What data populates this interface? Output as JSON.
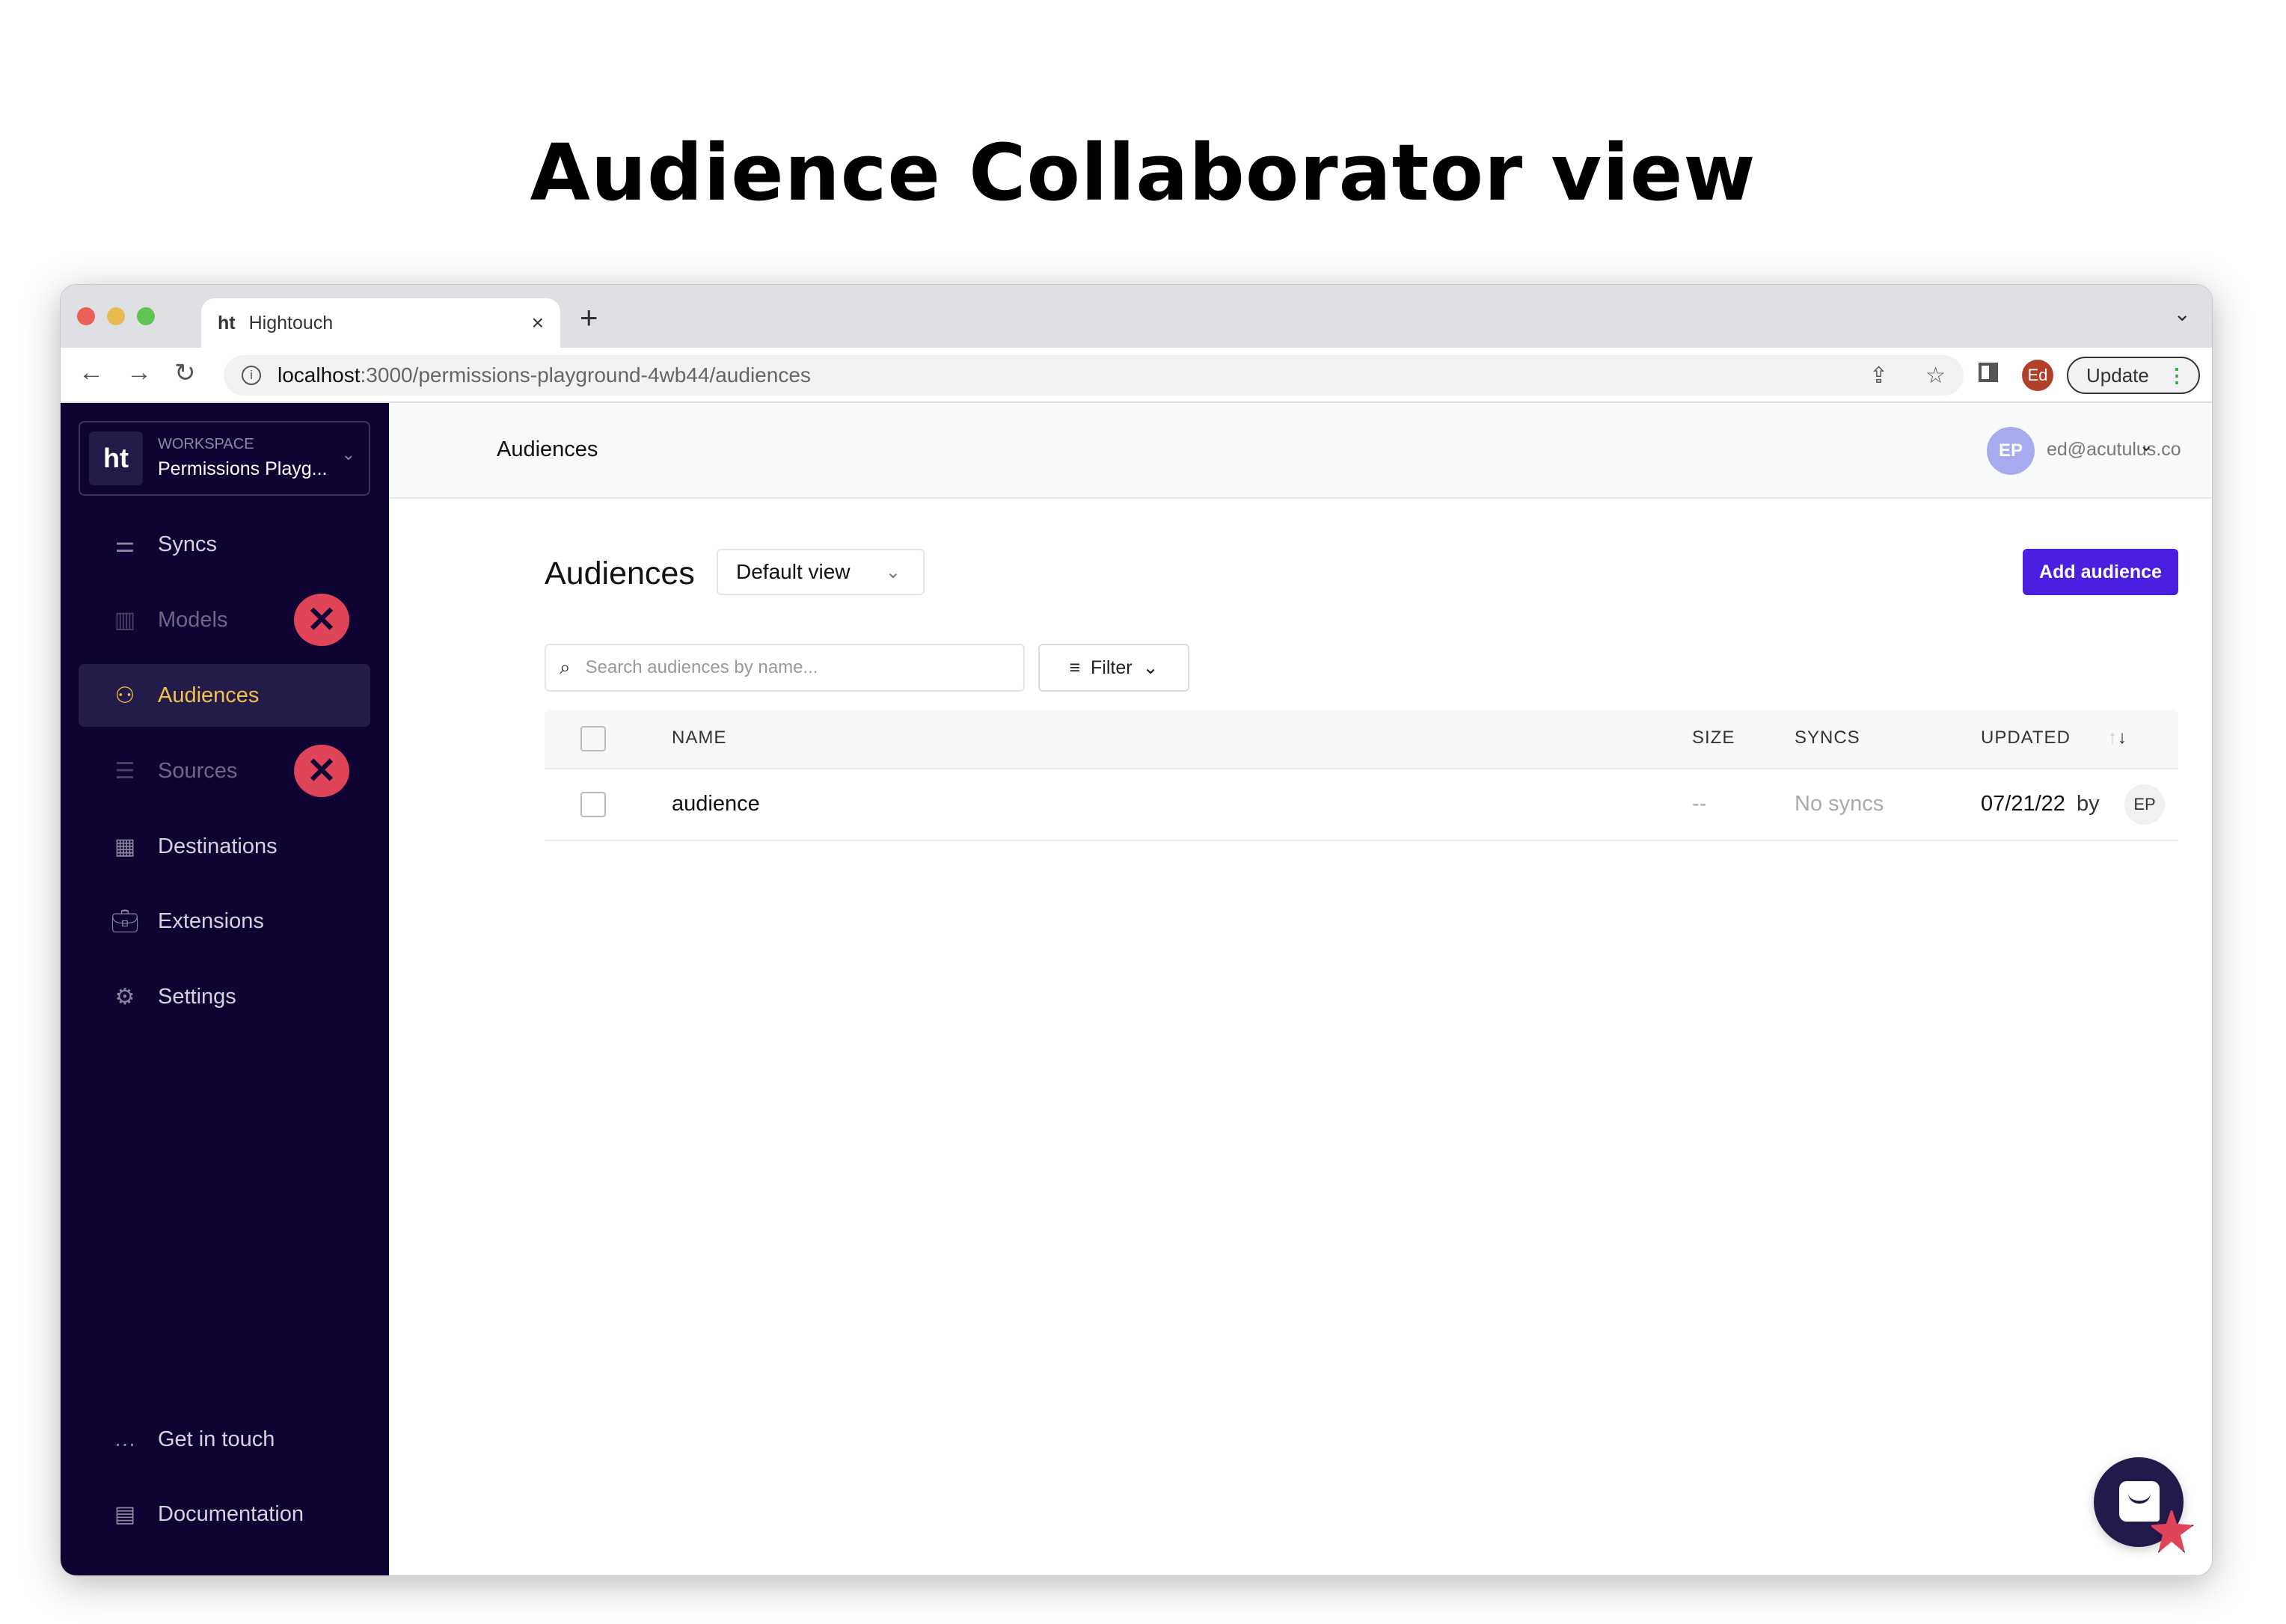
{
  "page_title": "Audience Collaborator view",
  "browser": {
    "tab_logo": "ht",
    "tab_title": "Hightouch",
    "tab_close": "×",
    "new_tab": "+",
    "tab_menu": "⌄",
    "url_host": "localhost",
    "url_path": ":3000/permissions-playground-4wb44/audiences",
    "profile": "Ed",
    "update": "Update"
  },
  "sidebar": {
    "workspace_logo": "ht",
    "workspace_label": "WORKSPACE",
    "workspace_name": "Permissions Playg...",
    "items": [
      {
        "label": "Syncs",
        "icon": "syncs-icon",
        "state": "enabled"
      },
      {
        "label": "Models",
        "icon": "chart-icon",
        "state": "disabled"
      },
      {
        "label": "Audiences",
        "icon": "users-icon",
        "state": "active"
      },
      {
        "label": "Sources",
        "icon": "database-icon",
        "state": "disabled"
      },
      {
        "label": "Destinations",
        "icon": "grid-icon",
        "state": "enabled"
      },
      {
        "label": "Extensions",
        "icon": "briefcase-icon",
        "state": "enabled"
      },
      {
        "label": "Settings",
        "icon": "gear-icon",
        "state": "enabled"
      }
    ],
    "bottom": [
      {
        "label": "Get in touch",
        "icon": "chat-icon"
      },
      {
        "label": "Documentation",
        "icon": "book-icon"
      }
    ],
    "x_mark": "✕"
  },
  "header": {
    "breadcrumb": "Audiences",
    "avatar": "EP",
    "email": "ed@acutulus.co"
  },
  "main": {
    "title": "Audiences",
    "view": "Default view",
    "add": "Add audience",
    "search_placeholder": "Search audiences by name...",
    "filter": "Filter",
    "columns": [
      "NAME",
      "SIZE",
      "SYNCS",
      "UPDATED"
    ],
    "rows": [
      {
        "name": "audience",
        "size": "--",
        "syncs": "No syncs",
        "updated": "07/21/22",
        "by": "by",
        "avatar": "EP"
      }
    ]
  },
  "colors": {
    "sidebar": "#0e0333",
    "accent": "#4a1fe0",
    "active": "#f2c04e",
    "deny": "#df4459"
  }
}
